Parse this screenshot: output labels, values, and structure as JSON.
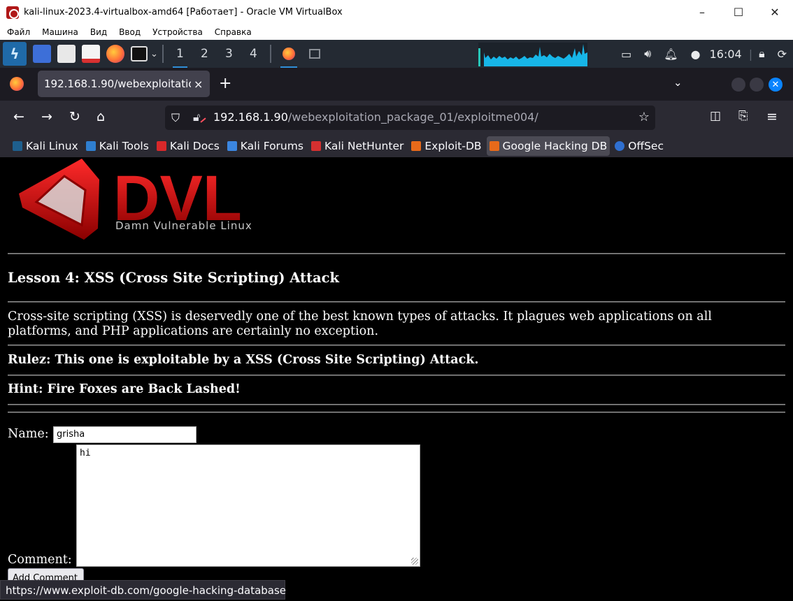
{
  "vbox": {
    "title": "kali-linux-2023.4-virtualbox-amd64 [Работает] - Oracle VM VirtualBox",
    "menu": [
      "Файл",
      "Машина",
      "Вид",
      "Ввод",
      "Устройства",
      "Справка"
    ],
    "window_buttons": {
      "minimize": "–",
      "maximize": "☐",
      "close": "✕"
    }
  },
  "kali_panel": {
    "workspaces": [
      "1",
      "2",
      "3",
      "4"
    ],
    "active_workspace": "1",
    "clock": "16:04",
    "accent": "#2f8fd8"
  },
  "firefox": {
    "tab": {
      "label": "192.168.1.90/webexploitation_package_01/exploitme004/",
      "close": "×"
    },
    "new_tab": "+",
    "url": {
      "host": "192.168.1.90",
      "path": "/webexploitation_package_01/exploitme004/"
    },
    "bookmarks": [
      {
        "label": "Kali Linux",
        "color": "#1e5f8e"
      },
      {
        "label": "Kali Tools",
        "color": "#2f7fd0"
      },
      {
        "label": "Kali Docs",
        "color": "#d8282a"
      },
      {
        "label": "Kali Forums",
        "color": "#3b86e0"
      },
      {
        "label": "Kali NetHunter",
        "color": "#d43030"
      },
      {
        "label": "Exploit-DB",
        "color": "#e86a1a"
      },
      {
        "label": "Google Hacking DB",
        "color": "#e86a1a"
      },
      {
        "label": "OffSec",
        "color": "#2f6fd0"
      }
    ],
    "status_url": "https://www.exploit-db.com/google-hacking-database"
  },
  "page": {
    "logo_text": "DVL",
    "logo_subtitle": "Damn Vulnerable Linux",
    "lesson_title": "Lesson 4: XSS (Cross Site Scripting) Attack",
    "intro": "Cross-site scripting (XSS) is deservedly one of the best known types of attacks. It plagues web applications on all platforms, and PHP applications are certainly no exception.",
    "rulez": "Rulez: This one is exploitable by a XSS (Cross Site Scripting) Attack.",
    "hint": "Hint: Fire Foxes are Back Lashed!",
    "form": {
      "name_label": "Name:",
      "name_value": "grisha",
      "comment_label": "Comment:",
      "comment_value": "hi",
      "submit_label": "Add Comment"
    }
  }
}
